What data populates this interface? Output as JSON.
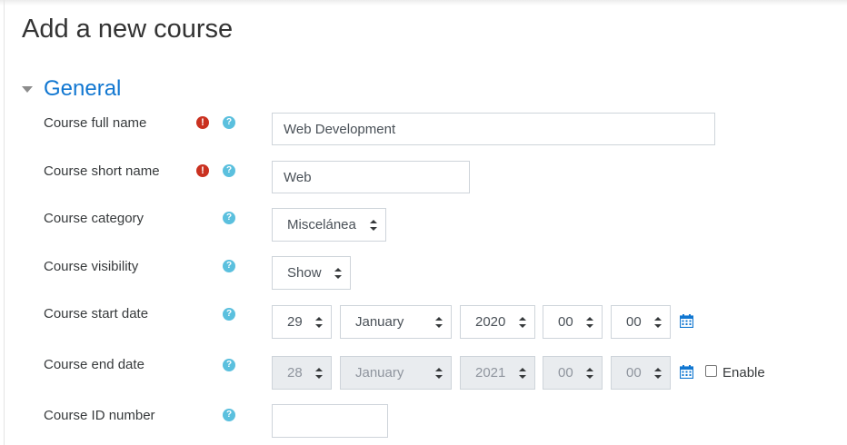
{
  "page_title": "Add a new course",
  "section": {
    "title": "General"
  },
  "icons": {
    "required": "!",
    "help": "?"
  },
  "fields": {
    "full_name": {
      "label": "Course full name",
      "value": "Web Development"
    },
    "short_name": {
      "label": "Course short name",
      "value": "Web"
    },
    "category": {
      "label": "Course category",
      "selected": "Miscelánea"
    },
    "visibility": {
      "label": "Course visibility",
      "selected": "Show"
    },
    "start_date": {
      "label": "Course start date",
      "day": "29",
      "month": "January",
      "year": "2020",
      "hour": "00",
      "minute": "00"
    },
    "end_date": {
      "label": "Course end date",
      "day": "28",
      "month": "January",
      "year": "2021",
      "hour": "00",
      "minute": "00",
      "enable_label": "Enable",
      "enabled": false
    },
    "id_number": {
      "label": "Course ID number",
      "value": ""
    }
  },
  "colors": {
    "accent": "#1177d1",
    "required": "#ca3120",
    "help": "#5bc0de",
    "calendar": "#1177d1"
  }
}
